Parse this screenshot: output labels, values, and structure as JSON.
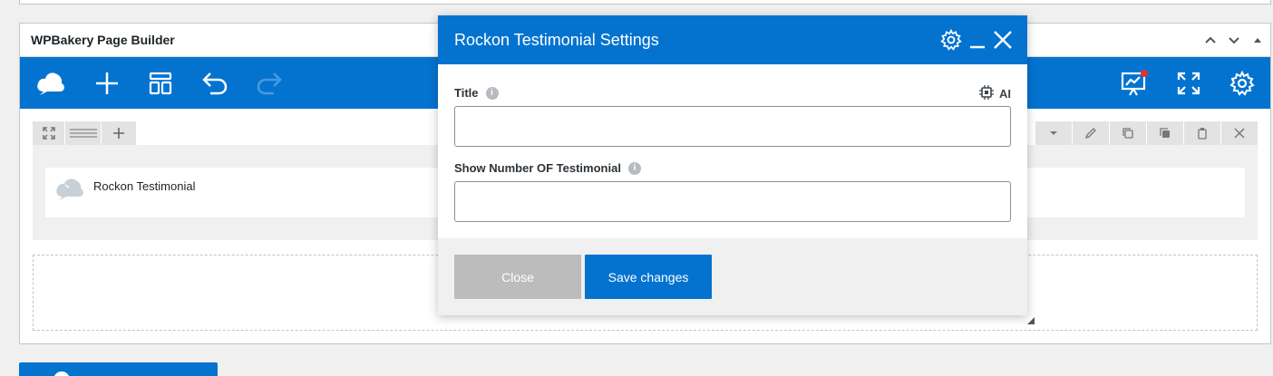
{
  "builder": {
    "title": "WPBakery Page Builder",
    "icons": {
      "logo": "cloud-logo-icon",
      "add": "plus-icon",
      "templates": "layout-templates-icon",
      "undo": "undo-icon",
      "redo": "redo-icon",
      "seo": "seo-chart-icon",
      "fullscreen": "fullscreen-icon",
      "settings": "gear-icon"
    },
    "element_label": "Rockon Testimonial",
    "accent_color": "#0473d0",
    "notification_color": "#e5322d"
  },
  "modal": {
    "title": "Rockon Testimonial Settings",
    "fields": [
      {
        "label": "Title",
        "value": ""
      },
      {
        "label": "Show Number OF Testimonial",
        "value": ""
      }
    ],
    "ai_label": "AI",
    "close_label": "Close",
    "save_label": "Save changes"
  }
}
